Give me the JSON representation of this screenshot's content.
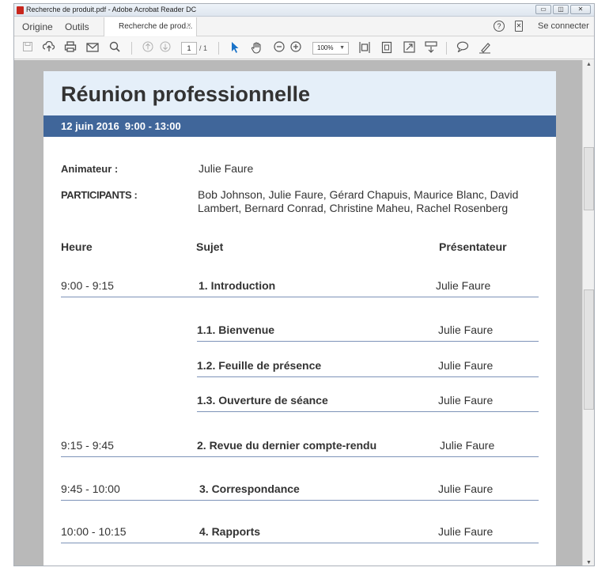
{
  "window": {
    "title": "Recherche de produit.pdf - Adobe Acrobat Reader DC",
    "controls": {
      "minimize": "▭",
      "restore": "◫",
      "close": "✕"
    }
  },
  "menubar": {
    "home": "Origine",
    "tools": "Outils",
    "doc_tab": "Recherche de prod...",
    "doc_tab_close": "×",
    "help": "?",
    "mobile": "✕",
    "sign_in": "Se connecter"
  },
  "toolbar": {
    "page_current": "1",
    "page_total": "/ 1",
    "zoom": "100%",
    "icons": [
      "save-icon",
      "cloud-upload-icon",
      "print-icon",
      "email-icon",
      "search-icon",
      "prev-page-icon",
      "next-page-icon",
      "select-pointer-icon",
      "hand-icon",
      "zoom-out-icon",
      "zoom-in-icon",
      "fit-width-icon",
      "fit-page-icon",
      "full-screen-icon",
      "read-mode-icon",
      "comment-icon",
      "sign-icon"
    ]
  },
  "document": {
    "title": "Réunion professionnelle",
    "date": "12 juin 2016  9:00 - 13:00",
    "facilitator_label": "Animateur :",
    "facilitator": "Julie Faure",
    "participants_label": "PARTICIPANTS :",
    "participants": "Bob Johnson, Julie Faure, Gérard Chapuis, Maurice Blanc, David Lambert, Bernard Conrad, Christine Maheu, Rachel Rosenberg",
    "columns": {
      "time": "Heure",
      "subject": "Sujet",
      "presenter": "Présentateur"
    },
    "rows": [
      {
        "time": "9:00 - 9:15",
        "subject": "1. Introduction",
        "presenter": "Julie Faure"
      },
      {
        "time": "",
        "subject": "1.1. Bienvenue",
        "presenter": "Julie Faure"
      },
      {
        "time": "",
        "subject": "1.2. Feuille de présence",
        "presenter": "Julie Faure"
      },
      {
        "time": "",
        "subject": "1.3. Ouverture de séance",
        "presenter": "Julie Faure"
      },
      {
        "time": "9:15 - 9:45",
        "subject": "2. Revue du dernier compte-rendu",
        "presenter": "Julie Faure"
      },
      {
        "time": "9:45 - 10:00",
        "subject": "3. Correspondance",
        "presenter": "Julie Faure"
      },
      {
        "time": "10:00 - 10:15",
        "subject": "4. Rapports",
        "presenter": "Julie Faure"
      }
    ]
  }
}
